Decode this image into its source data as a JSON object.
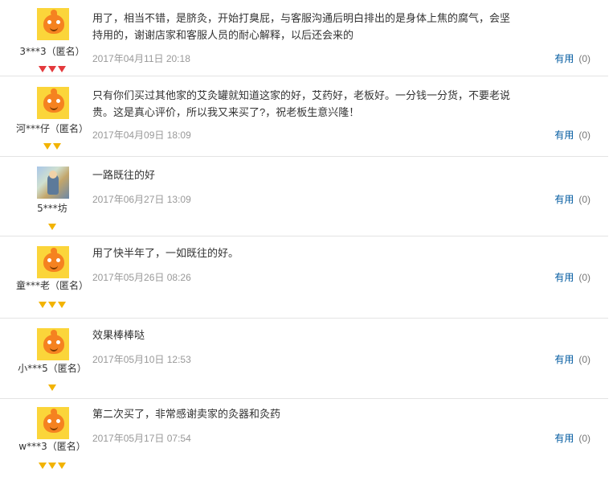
{
  "reviews": [
    {
      "user": "3***3（匿名）",
      "avatar": "mascot",
      "badge_icon": "red-diamond-icon",
      "badge_count": 3,
      "content": "用了，相当不错，是脐灸，开始打臭屁，与客服沟通后明白排出的是身体上焦的腐气，会坚持用的，谢谢店家和客服人员的耐心解释，以后还会来的",
      "date": "2017年04月11日 20:18",
      "useful_label": "有用",
      "useful_count": "(0)"
    },
    {
      "user": "河***仔（匿名）",
      "avatar": "mascot",
      "badge_icon": "gold-diamond-icon",
      "badge_count": 2,
      "content": "只有你们买过其他家的艾灸罐就知道这家的好，艾药好，老板好。一分钱一分货，不要老说贵。这是真心评价，所以我又来买了?，祝老板生意兴隆！",
      "date": "2017年04月09日 18:09",
      "useful_label": "有用",
      "useful_count": "(0)"
    },
    {
      "user": "5***坊",
      "avatar": "photo",
      "badge_icon": "gold-diamond-icon",
      "badge_count": 1,
      "content": "一路既往的好",
      "date": "2017年06月27日 13:09",
      "useful_label": "有用",
      "useful_count": "(0)"
    },
    {
      "user": "童***老（匿名）",
      "avatar": "mascot",
      "badge_icon": "gold-diamond-icon",
      "badge_count": 3,
      "content": "用了快半年了，一如既往的好。",
      "date": "2017年05月26日 08:26",
      "useful_label": "有用",
      "useful_count": "(0)"
    },
    {
      "user": "小***5（匿名）",
      "avatar": "mascot",
      "badge_icon": "gold-diamond-icon",
      "badge_count": 1,
      "content": "效果棒棒哒",
      "date": "2017年05月10日 12:53",
      "useful_label": "有用",
      "useful_count": "(0)"
    },
    {
      "user": "w***3（匿名）",
      "avatar": "mascot",
      "badge_icon": "gold-diamond-icon",
      "badge_count": 3,
      "content": "第二次买了，非常感谢卖家的灸器和灸药",
      "date": "2017年05月17日 07:54",
      "useful_label": "有用",
      "useful_count": "(0)"
    }
  ]
}
